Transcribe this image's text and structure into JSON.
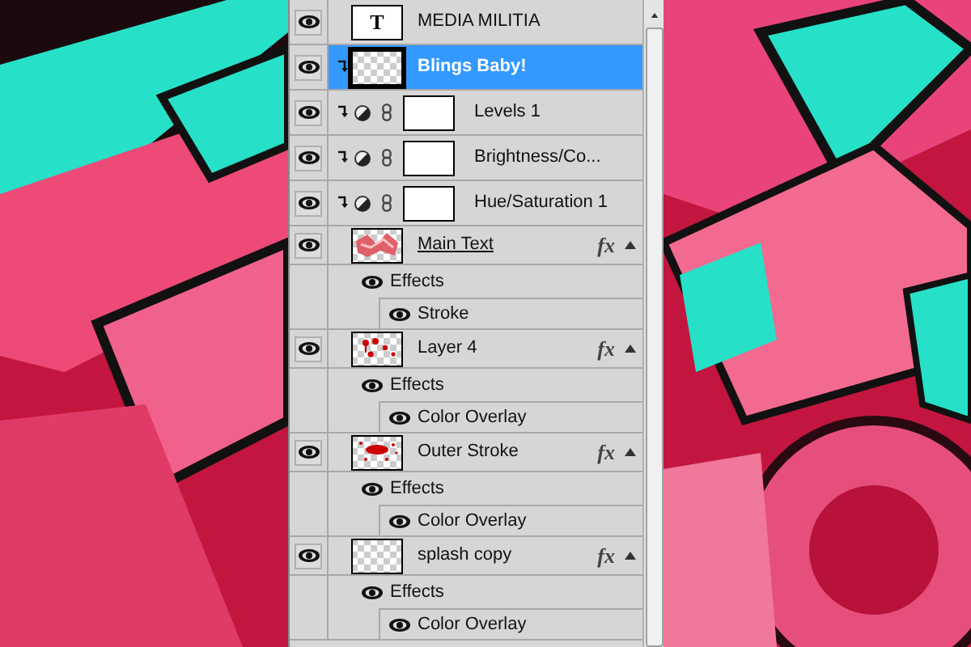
{
  "layers": [
    {
      "kind": "text",
      "thumb": {
        "kind": "text",
        "text": "T"
      },
      "name": "MEDIA MILITIA",
      "selected": false,
      "visible": true,
      "clipped": false,
      "underlined": false
    },
    {
      "kind": "pixel",
      "thumb": {
        "kind": "transparent"
      },
      "name": "Blings Baby!",
      "selected": true,
      "visible": true,
      "clipped": true,
      "underlined": false
    },
    {
      "kind": "adjustment",
      "name": "Levels 1",
      "selected": false,
      "visible": true,
      "clipped": true,
      "underlined": false
    },
    {
      "kind": "adjustment",
      "name": "Brightness/Co...",
      "selected": false,
      "visible": true,
      "clipped": true,
      "underlined": false
    },
    {
      "kind": "adjustment",
      "name": "Hue/Saturation 1",
      "selected": false,
      "visible": true,
      "clipped": true,
      "underlined": false
    },
    {
      "kind": "pixel",
      "thumb": {
        "kind": "lettering"
      },
      "name": "Main Text",
      "selected": false,
      "visible": true,
      "clipped": false,
      "underlined": true,
      "fx": "fx",
      "effects_label": "Effects",
      "effects": [
        "Stroke"
      ]
    },
    {
      "kind": "pixel",
      "thumb": {
        "kind": "drops"
      },
      "name": "Layer 4",
      "selected": false,
      "visible": true,
      "clipped": false,
      "underlined": false,
      "fx": "fx",
      "effects_label": "Effects",
      "effects": [
        "Color Overlay"
      ]
    },
    {
      "kind": "pixel",
      "thumb": {
        "kind": "splatter"
      },
      "name": "Outer Stroke",
      "selected": false,
      "visible": true,
      "clipped": false,
      "underlined": false,
      "fx": "fx",
      "effects_label": "Effects",
      "effects": [
        "Color Overlay"
      ]
    },
    {
      "kind": "pixel",
      "thumb": {
        "kind": "transparent"
      },
      "name": "splash copy",
      "selected": false,
      "visible": true,
      "clipped": false,
      "underlined": false,
      "fx": "fx",
      "effects_label": "Effects",
      "effects": [
        "Color Overlay"
      ]
    }
  ]
}
